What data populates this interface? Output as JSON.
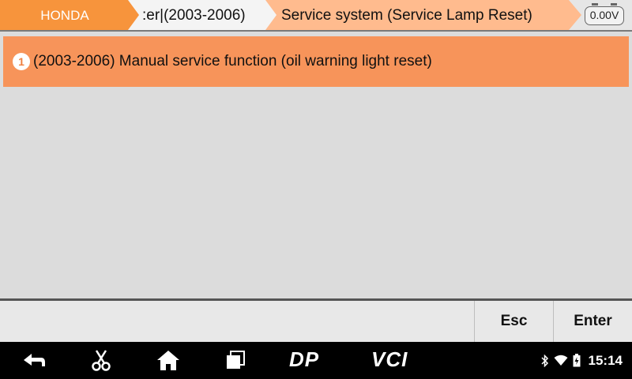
{
  "breadcrumb": {
    "make": "HONDA",
    "model": ":er|(2003-2006)",
    "function": "Service system (Service Lamp Reset)"
  },
  "battery_voltage": "0.00V",
  "menu": {
    "items": [
      {
        "index": "1",
        "label": "(2003-2006) Manual service function (oil warning light reset)"
      }
    ]
  },
  "actions": {
    "esc_label": "Esc",
    "enter_label": "Enter"
  },
  "navbar": {
    "icons": [
      "back-icon",
      "scissors-icon",
      "home-icon",
      "recent-apps-icon",
      "dp-icon",
      "vci-icon"
    ],
    "dp_label": "DP",
    "vci_label": "VCI"
  },
  "status": {
    "time": "15:14",
    "icons": [
      "bluetooth-icon",
      "wifi-icon",
      "battery-icon"
    ]
  },
  "colors": {
    "accent": "#f7943c",
    "selected_row": "#f7945a",
    "active_crumb": "#ffbb8e",
    "background": "#dcdcdc"
  }
}
